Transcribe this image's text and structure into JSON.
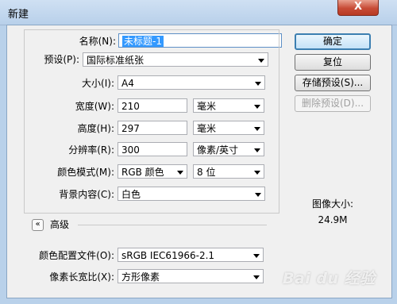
{
  "window": {
    "title": "新建",
    "close_symbol": "X"
  },
  "form": {
    "name": {
      "label": "名称(N):",
      "value": "未标题-1"
    },
    "preset": {
      "label": "预设(P):",
      "value": "国际标准纸张"
    },
    "size": {
      "label": "大小(I):",
      "value": "A4"
    },
    "width": {
      "label": "宽度(W):",
      "value": "210",
      "unit": "毫米"
    },
    "height": {
      "label": "高度(H):",
      "value": "297",
      "unit": "毫米"
    },
    "resolution": {
      "label": "分辨率(R):",
      "value": "300",
      "unit": "像素/英寸"
    },
    "color_mode": {
      "label": "颜色模式(M):",
      "value": "RGB 颜色",
      "depth": "8 位"
    },
    "background": {
      "label": "背景内容(C):",
      "value": "白色"
    }
  },
  "advanced": {
    "toggle_symbol": "«",
    "label": "高级",
    "color_profile": {
      "label": "颜色配置文件(O):",
      "value": "sRGB IEC61966-2.1"
    },
    "pixel_aspect": {
      "label": "像素长宽比(X):",
      "value": "方形像素"
    }
  },
  "buttons": {
    "ok": "确定",
    "reset": "复位",
    "save_preset": "存储预设(S)...",
    "delete_preset": "删除预设(D)..."
  },
  "image_size": {
    "label": "图像大小:",
    "value": "24.9M"
  },
  "watermark": "Bai du 经验",
  "colors": {
    "accent": "#3399ff",
    "window_frame": "#b9d1ea",
    "close_button": "#c74b36"
  }
}
